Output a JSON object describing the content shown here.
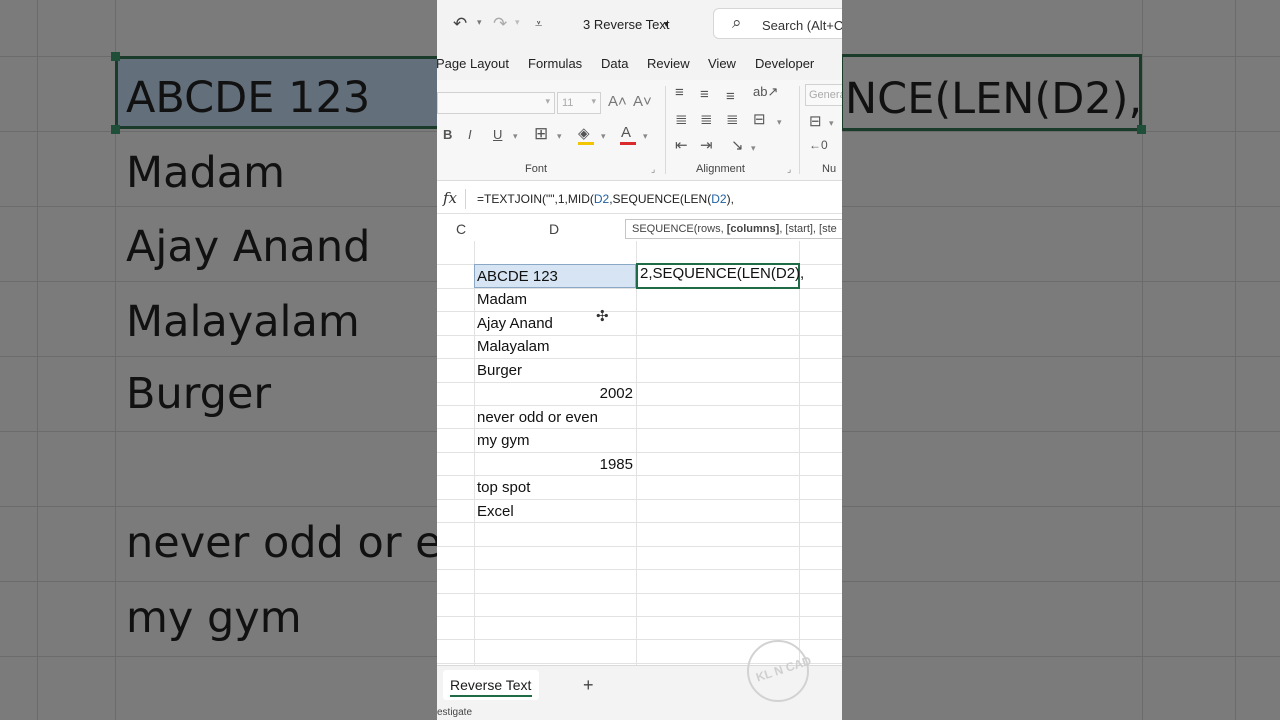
{
  "background": {
    "cells": [
      "ABCDE 123",
      "Madam",
      "Ajay Anand",
      "Malayalam",
      "Burger",
      "never odd or e",
      "my gym"
    ],
    "formula_fragment": "NCE(LEN(D2),"
  },
  "titlebar": {
    "doc_title": "3 Reverse Text",
    "search_placeholder": "Search (Alt+C"
  },
  "menu": {
    "tabs": [
      "Page Layout",
      "Formulas",
      "Data",
      "Review",
      "View",
      "Developer"
    ]
  },
  "ribbon": {
    "font_size": "11",
    "font_group_label": "Font",
    "alignment_group_label": "Alignment",
    "number_group_label": "Nu",
    "number_format": "Genera",
    "bold_label": "B",
    "italic_label": "I",
    "underline_label": "U"
  },
  "formula_bar": {
    "fx_label": "fx",
    "part1": "=TEXTJOIN(\"\",1,MID(",
    "ref1": "D2",
    "part2": ",SEQUENCE(LEN(",
    "ref2": "D2",
    "part3": "),"
  },
  "tooltip": {
    "prefix": "SEQUENCE(rows, ",
    "bold_arg": "[columns]",
    "suffix": ", [start], [ste"
  },
  "columns": [
    "C",
    "D"
  ],
  "grid": {
    "d_column": [
      {
        "value": "ABCDE 123",
        "type": "text"
      },
      {
        "value": "Madam",
        "type": "text"
      },
      {
        "value": "Ajay Anand",
        "type": "text"
      },
      {
        "value": "Malayalam",
        "type": "text"
      },
      {
        "value": "Burger",
        "type": "text"
      },
      {
        "value": "2002",
        "type": "number"
      },
      {
        "value": "never odd or even",
        "type": "text"
      },
      {
        "value": "my gym",
        "type": "text"
      },
      {
        "value": "1985",
        "type": "number"
      },
      {
        "value": "top spot",
        "type": "text"
      },
      {
        "value": "Excel",
        "type": "text"
      }
    ],
    "edit_cell_text": "2,SEQUENCE(LEN(D2),"
  },
  "sheet_tabs": {
    "active": "Reverse Text",
    "add_label": "+"
  },
  "status_bar": {
    "text": "estigate"
  },
  "watermark": {
    "text": "KL N CAD"
  },
  "colors": {
    "accent_green": "#1f6b45",
    "selection_fill": "#d6e4f3",
    "reference_blue": "#1f5f9f"
  }
}
